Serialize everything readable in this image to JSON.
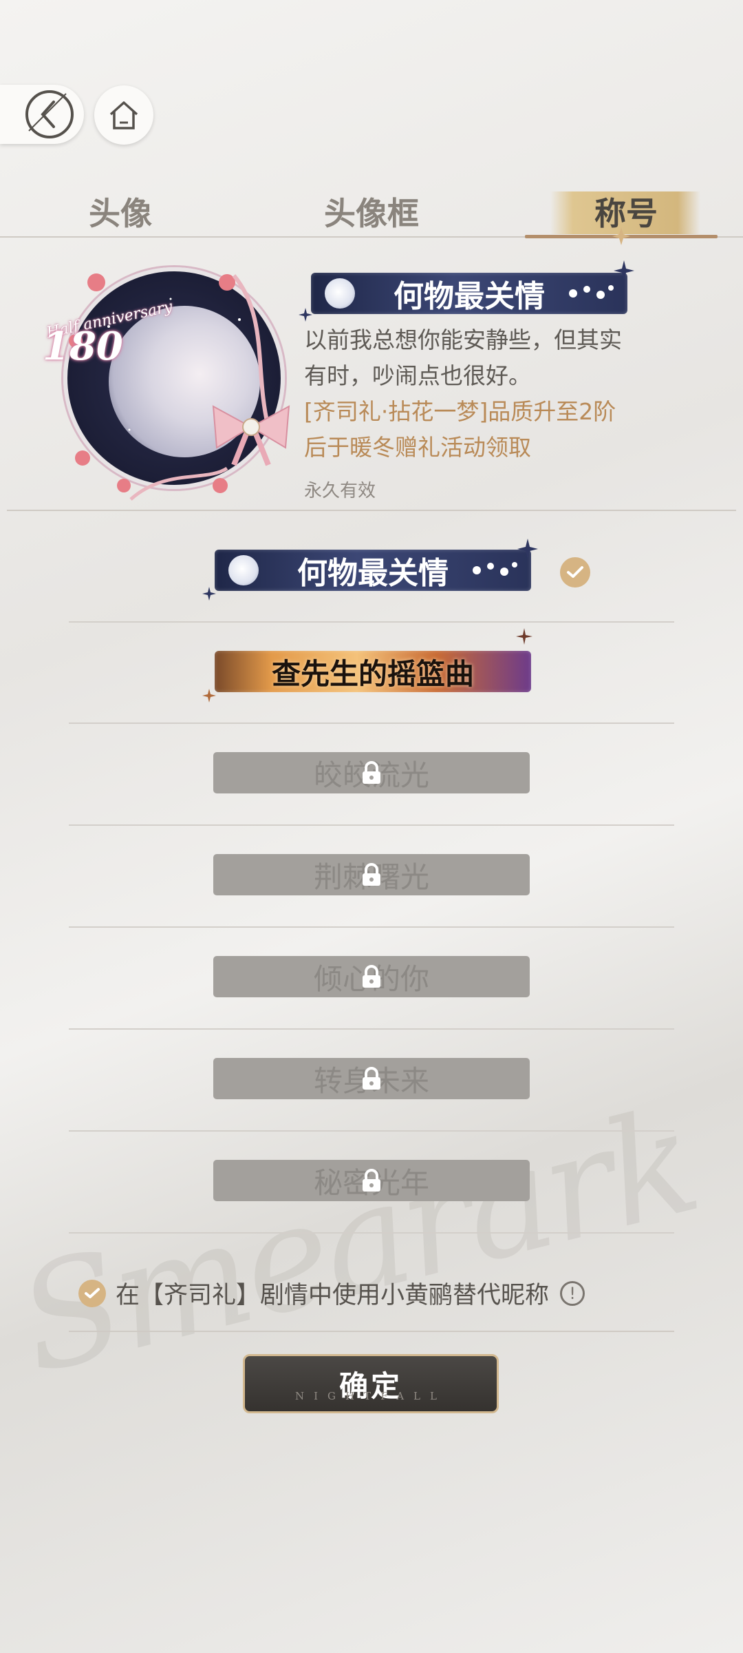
{
  "tabs": [
    {
      "label": "头像"
    },
    {
      "label": "头像框"
    },
    {
      "label": "称号",
      "active": true
    }
  ],
  "profile": {
    "anniversary_text": "Half anniversary",
    "anniversary_number": "180",
    "title_name": "何物最关情",
    "description": "以前我总想你能安静些，但其实有时，吵闹点也很好。",
    "unlock_note": "[齐司礼·拈花一梦]品质升至2阶后于暖冬赠礼活动领取",
    "validity": "永久有效"
  },
  "titles": [
    {
      "name": "何物最关情",
      "state": "selected"
    },
    {
      "name": "查先生的摇篮曲",
      "state": "owned"
    },
    {
      "name": "皎皎流光",
      "state": "locked"
    },
    {
      "name": "荆棘曙光",
      "state": "locked"
    },
    {
      "name": "倾心的你",
      "state": "locked"
    },
    {
      "name": "转身未来",
      "state": "locked"
    },
    {
      "name": "秘密光年",
      "state": "locked"
    }
  ],
  "option": {
    "label": "在【齐司礼】剧情中使用小黄鹂替代昵称",
    "checked": true,
    "info_symbol": "!"
  },
  "confirm": {
    "label": "确定",
    "sub": "NIGHTFALL"
  },
  "watermark_text": "Smearark",
  "colors": {
    "accent_gold": "#d6b483",
    "tab_underline": "#b38e6a",
    "banner_navy": "#2a335a",
    "note_gold": "#b98a57",
    "locked_gray": "#a3a09c",
    "button_dark": "#3f3c39"
  }
}
